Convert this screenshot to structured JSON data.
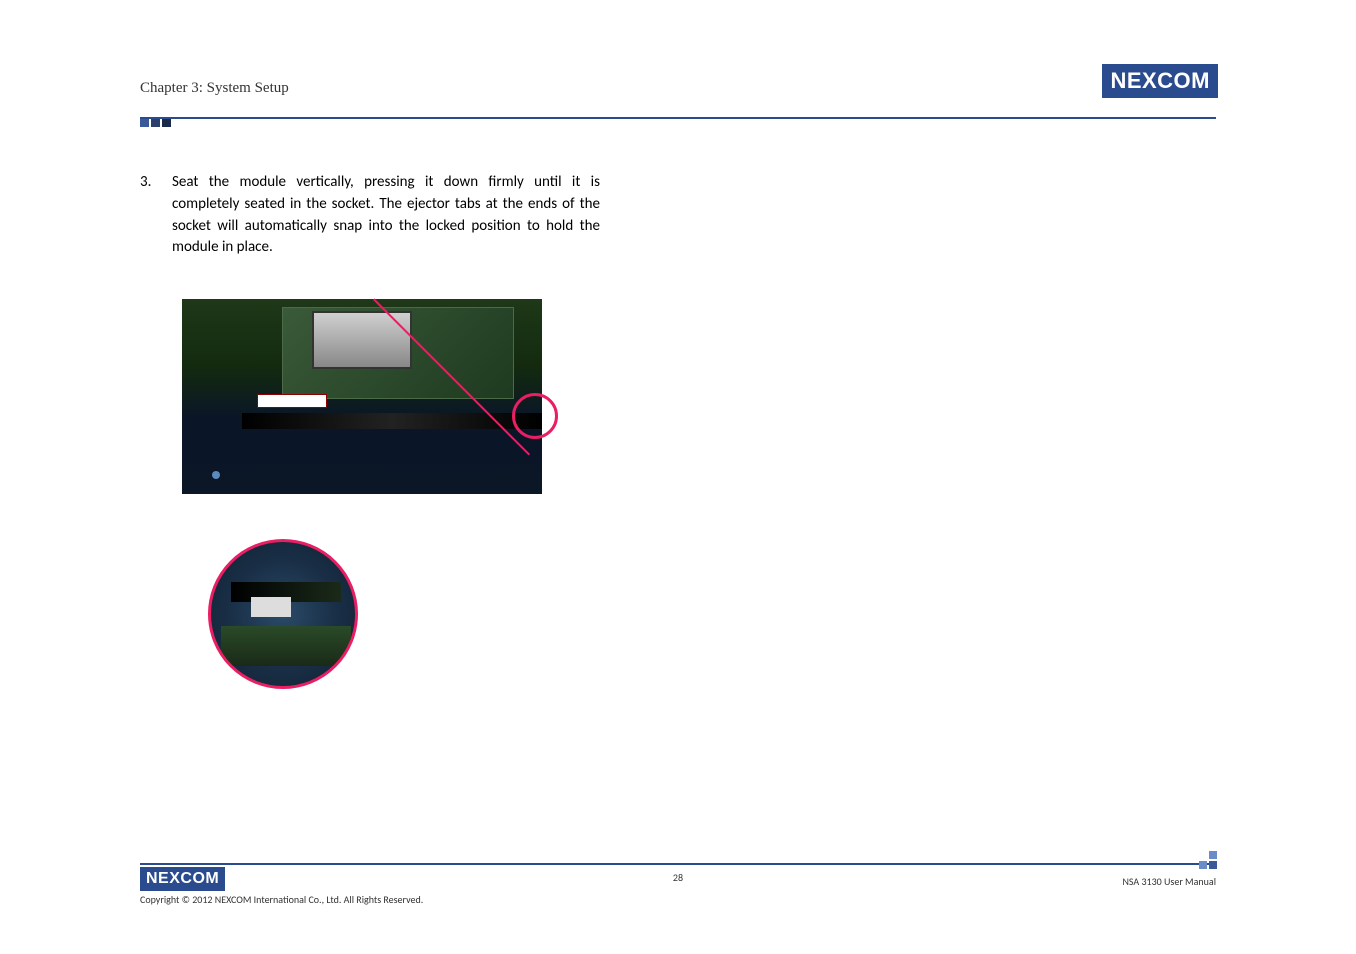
{
  "header": {
    "chapter_title": "Chapter 3: System Setup",
    "logo_text": "NEXCOM"
  },
  "content": {
    "step_number": "3.",
    "step_text": "Seat the module vertically, pressing it down firmly until it is completely seated in the socket. The ejector tabs at the ends of the socket will automatically snap into the locked position to hold the module in place."
  },
  "footer": {
    "logo_text": "NEXCOM",
    "copyright": "Copyright © 2012 NEXCOM International Co., Ltd. All Rights Reserved.",
    "page_number": "28",
    "manual_name": "NSA 3130 User Manual"
  }
}
